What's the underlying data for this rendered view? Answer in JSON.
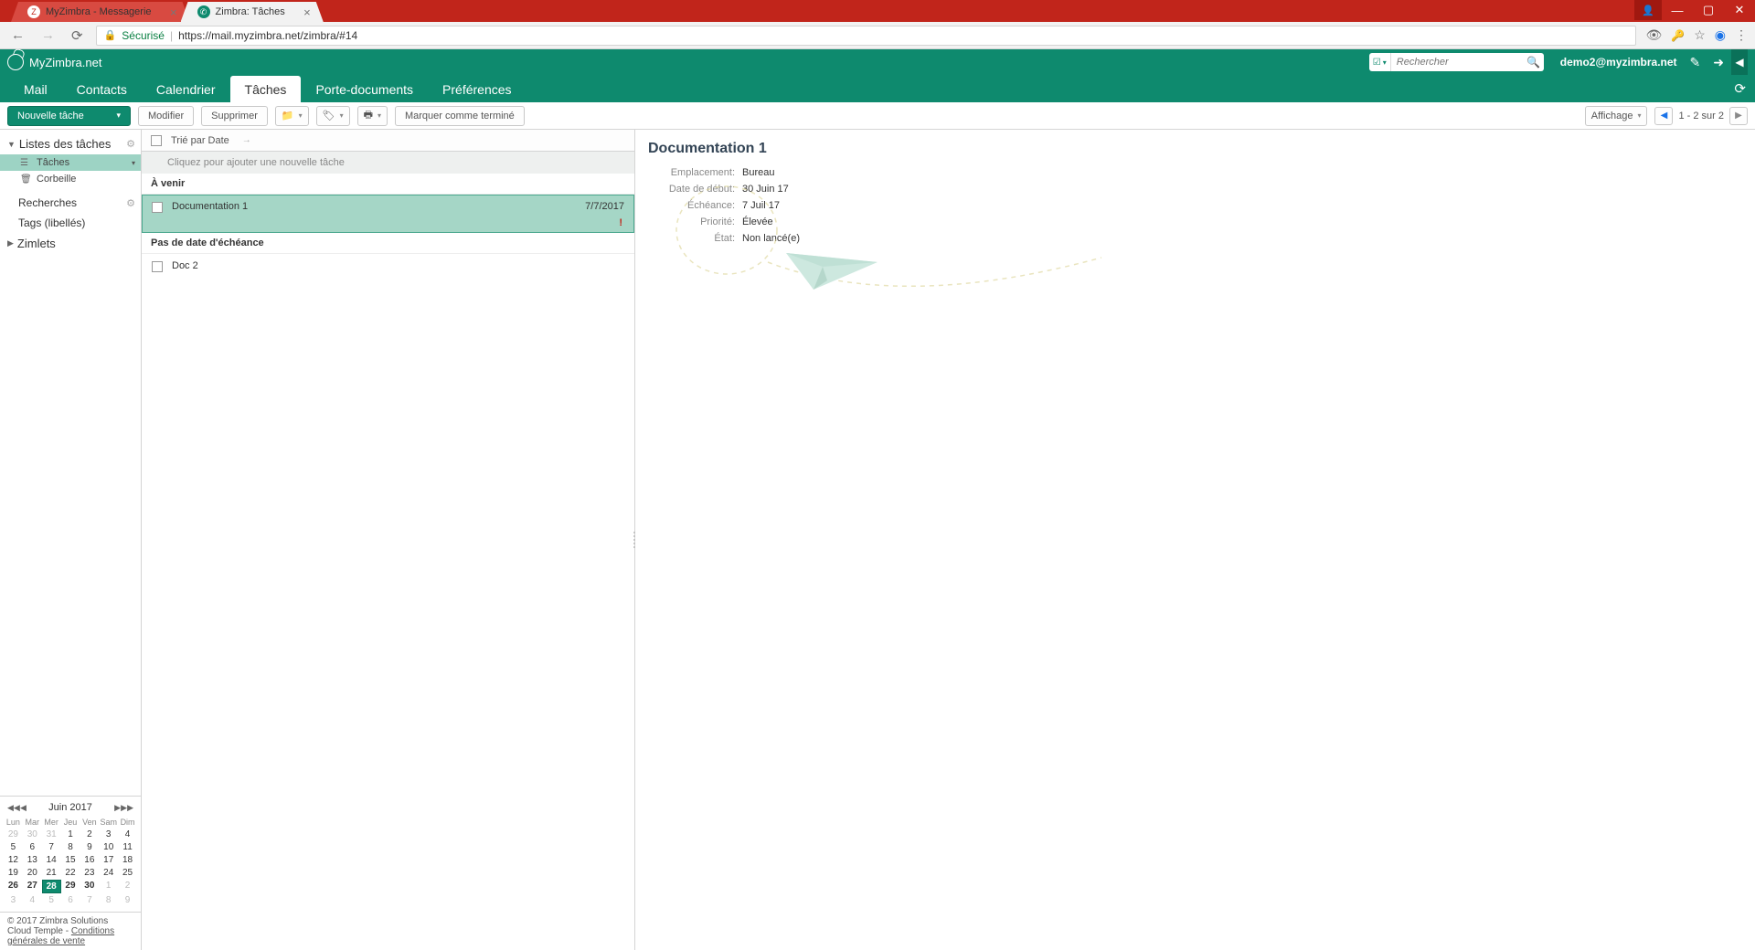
{
  "browser": {
    "tabs": [
      {
        "title": "MyZimbra - Messagerie",
        "active": false
      },
      {
        "title": "Zimbra: Tâches",
        "active": true
      }
    ],
    "url_secure": "Sécurisé",
    "url": "https://mail.myzimbra.net/zimbra/#14"
  },
  "header": {
    "logo_text": "MyZimbra.net",
    "search_placeholder": "Rechercher",
    "user": "demo2@myzimbra.net"
  },
  "tabs": [
    "Mail",
    "Contacts",
    "Calendrier",
    "Tâches",
    "Porte-documents",
    "Préférences"
  ],
  "active_tab": "Tâches",
  "toolbar": {
    "new_label": "Nouvelle tâche",
    "edit": "Modifier",
    "delete": "Supprimer",
    "mark_done": "Marquer comme terminé",
    "view": "Affichage",
    "pager": "1 - 2 sur 2"
  },
  "sidebar": {
    "lists_header": "Listes des tâches",
    "items": [
      {
        "label": "Tâches",
        "icon": "☰",
        "selected": true
      },
      {
        "label": "Corbeille",
        "icon": "🗑",
        "selected": false
      }
    ],
    "searches": "Recherches",
    "tags": "Tags (libellés)",
    "zimlets": "Zimlets"
  },
  "calendar": {
    "title": "Juin 2017",
    "dow": [
      "Lun",
      "Mar",
      "Mer",
      "Jeu",
      "Ven",
      "Sam",
      "Dim"
    ],
    "weeks": [
      [
        {
          "d": "29",
          "o": true
        },
        {
          "d": "30",
          "o": true
        },
        {
          "d": "31",
          "o": true
        },
        {
          "d": "1"
        },
        {
          "d": "2"
        },
        {
          "d": "3"
        },
        {
          "d": "4"
        }
      ],
      [
        {
          "d": "5"
        },
        {
          "d": "6"
        },
        {
          "d": "7"
        },
        {
          "d": "8"
        },
        {
          "d": "9"
        },
        {
          "d": "10"
        },
        {
          "d": "11"
        }
      ],
      [
        {
          "d": "12"
        },
        {
          "d": "13"
        },
        {
          "d": "14"
        },
        {
          "d": "15"
        },
        {
          "d": "16"
        },
        {
          "d": "17"
        },
        {
          "d": "18"
        }
      ],
      [
        {
          "d": "19"
        },
        {
          "d": "20"
        },
        {
          "d": "21"
        },
        {
          "d": "22"
        },
        {
          "d": "23"
        },
        {
          "d": "24"
        },
        {
          "d": "25"
        }
      ],
      [
        {
          "d": "26",
          "b": true
        },
        {
          "d": "27",
          "b": true
        },
        {
          "d": "28",
          "t": true,
          "b": true
        },
        {
          "d": "29",
          "b": true
        },
        {
          "d": "30",
          "b": true
        },
        {
          "d": "1",
          "o": true
        },
        {
          "d": "2",
          "o": true
        }
      ],
      [
        {
          "d": "3",
          "o": true
        },
        {
          "d": "4",
          "o": true
        },
        {
          "d": "5",
          "o": true
        },
        {
          "d": "6",
          "o": true
        },
        {
          "d": "7",
          "o": true
        },
        {
          "d": "8",
          "o": true
        },
        {
          "d": "9",
          "o": true
        }
      ]
    ]
  },
  "footer": {
    "copyright": "© 2017 Zimbra Solutions Cloud Temple - ",
    "cgv": "Conditions générales de vente"
  },
  "list": {
    "sort_label": "Trié par Date",
    "add_placeholder": "Cliquez pour ajouter une nouvelle tâche",
    "group_upcoming": "À venir",
    "group_nodate": "Pas de date d'échéance",
    "tasks": [
      {
        "title": "Documentation 1",
        "date": "7/7/2017",
        "selected": true,
        "high_priority": true
      },
      {
        "title": "Doc 2",
        "date": "",
        "selected": false,
        "high_priority": false
      }
    ]
  },
  "detail": {
    "title": "Documentation 1",
    "fields": [
      {
        "label": "Emplacement:",
        "value": "Bureau"
      },
      {
        "label": "Date de début:",
        "value": "30 Juin 17"
      },
      {
        "label": "Échéance:",
        "value": "7 Juil 17"
      },
      {
        "label": "Priorité:",
        "value": "Élevée"
      },
      {
        "label": "État:",
        "value": "Non lancé(e)"
      }
    ]
  }
}
